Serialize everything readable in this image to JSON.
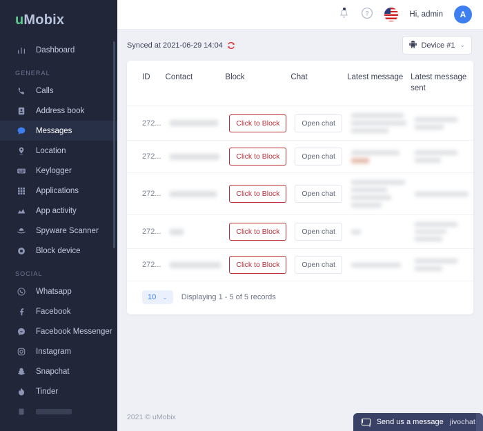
{
  "brand": {
    "logo_prefix": "u",
    "logo_suffix": "Mobix",
    "accent_green": "#5ec98f",
    "accent_blue": "#3d7ff0"
  },
  "topbar": {
    "bell_icon": "bell-icon",
    "help_icon": "help-circle-icon",
    "flag_icon": "us-flag-icon",
    "greeting": "Hi, admin",
    "avatar_initial": "A"
  },
  "syncbar": {
    "synced_text": "Synced at 2021-06-29 14:04",
    "refresh_icon": "refresh-icon",
    "device_label": "Device #1",
    "device_icon": "android-icon",
    "chevron": "⌄"
  },
  "sidebar": {
    "sections": [
      {
        "title": null,
        "items": [
          {
            "label": "Dashboard",
            "icon": "dashboard-bars-icon",
            "active": false
          }
        ]
      },
      {
        "title": "GENERAL",
        "items": [
          {
            "label": "Calls",
            "icon": "phone-icon",
            "active": false
          },
          {
            "label": "Address book",
            "icon": "contact-card-icon",
            "active": false
          },
          {
            "label": "Messages",
            "icon": "chat-bubble-icon",
            "active": true
          },
          {
            "label": "Location",
            "icon": "map-pin-icon",
            "active": false
          },
          {
            "label": "Keylogger",
            "icon": "keyboard-icon",
            "active": false
          },
          {
            "label": "Applications",
            "icon": "grid-apps-icon",
            "active": false
          },
          {
            "label": "App activity",
            "icon": "activity-chart-icon",
            "active": false
          },
          {
            "label": "Spyware Scanner",
            "icon": "spy-hat-icon",
            "active": false
          },
          {
            "label": "Block device",
            "icon": "block-circle-icon",
            "active": false
          }
        ]
      },
      {
        "title": "SOCIAL",
        "items": [
          {
            "label": "Whatsapp",
            "icon": "whatsapp-icon",
            "active": false
          },
          {
            "label": "Facebook",
            "icon": "facebook-icon",
            "active": false
          },
          {
            "label": "Facebook Messenger",
            "icon": "messenger-icon",
            "active": false
          },
          {
            "label": "Instagram",
            "icon": "instagram-icon",
            "active": false
          },
          {
            "label": "Snapchat",
            "icon": "snapchat-icon",
            "active": false
          },
          {
            "label": "Tinder",
            "icon": "tinder-flame-icon",
            "active": false
          }
        ]
      }
    ]
  },
  "table": {
    "headers": [
      "ID",
      "Contact",
      "Block",
      "Chat",
      "Latest message",
      "Latest message sent"
    ],
    "block_button_label": "Click to Block",
    "chat_button_label": "Open chat",
    "rows": [
      {
        "id": "272...",
        "contact": "[redacted]",
        "latest_message": "[redacted]",
        "latest_message_sent": "[redacted]"
      },
      {
        "id": "272...",
        "contact": "[redacted]",
        "latest_message": "[redacted]",
        "latest_message_sent": "[redacted]"
      },
      {
        "id": "272...",
        "contact": "[redacted]",
        "latest_message": "[redacted]",
        "latest_message_sent": "[redacted]"
      },
      {
        "id": "272...",
        "contact": "[redacted]",
        "latest_message": "[redacted]",
        "latest_message_sent": "[redacted]"
      },
      {
        "id": "272...",
        "contact": "[redacted]",
        "latest_message": "[redacted]",
        "latest_message_sent": "[redacted]"
      }
    ]
  },
  "pagination": {
    "per_page": "10",
    "chevron": "⌄",
    "records_text": "Displaying 1 - 5 of 5 records"
  },
  "footer": {
    "copyright": "2021 © uMobix"
  },
  "chat_widget": {
    "label": "Send us a message",
    "brand": "jivochat",
    "icon": "envelope-icon"
  }
}
